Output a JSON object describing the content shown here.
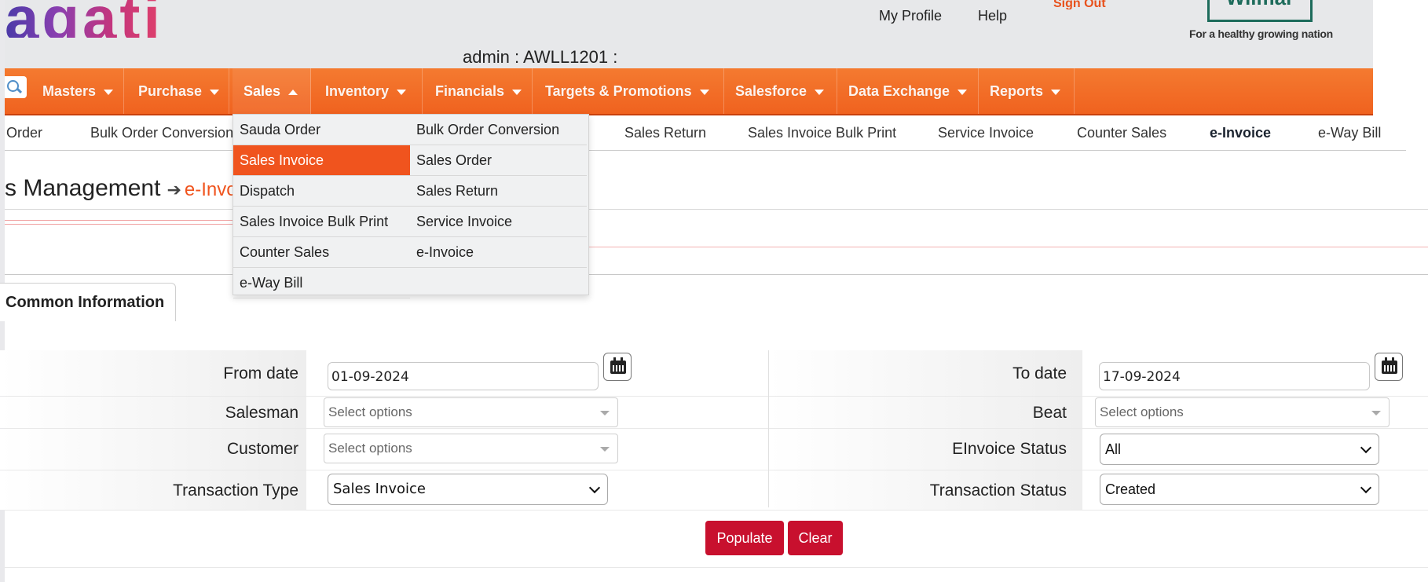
{
  "header": {
    "logo_text": "agati",
    "links": [
      "My Profile",
      "Help"
    ],
    "signout": "Sign Out",
    "brand_name": "Wilmar",
    "brand_tagline": "For a healthy growing nation",
    "user_line": "admin : AWLL1201 :"
  },
  "nav": {
    "items": [
      {
        "label": "Masters"
      },
      {
        "label": "Purchase"
      },
      {
        "label": "Sales"
      },
      {
        "label": "Inventory"
      },
      {
        "label": "Financials"
      },
      {
        "label": "Targets & Promotions"
      },
      {
        "label": "Salesforce"
      },
      {
        "label": "Data Exchange"
      },
      {
        "label": "Reports"
      }
    ],
    "active": "Sales"
  },
  "subnav": {
    "items": [
      "Order",
      "Bulk Order Conversion",
      "Sales Return",
      "Sales Invoice Bulk Print",
      "Service Invoice",
      "Counter Sales",
      "e-Invoice",
      "e-Way Bill"
    ],
    "active": "e-Invoice"
  },
  "page": {
    "title": "s Management",
    "breadcrumb": "e-Invc"
  },
  "dropdown": {
    "left": [
      "Sauda Order",
      "Sales Invoice",
      "Dispatch",
      "Sales Invoice Bulk Print",
      "Counter Sales",
      "e-Way Bill"
    ],
    "right": [
      "Bulk Order Conversion",
      "Sales Order",
      "Sales Return",
      "Service Invoice",
      "e-Invoice"
    ],
    "highlighted": "Sales Invoice",
    "highlight_color": "#f0541e"
  },
  "tab": {
    "label": "Common Information"
  },
  "form": {
    "from_date_label": "From date",
    "from_date_value": "01-09-2024",
    "to_date_label": "To date",
    "to_date_value": "17-09-2024",
    "salesman_label": "Salesman",
    "salesman_placeholder": "Select options",
    "beat_label": "Beat",
    "beat_placeholder": "Select options",
    "customer_label": "Customer",
    "customer_placeholder": "Select options",
    "einvoice_status_label": "EInvoice Status",
    "einvoice_status_value": "All",
    "transaction_type_label": "Transaction Type",
    "transaction_type_value": "Sales Invoice",
    "transaction_status_label": "Transaction Status",
    "transaction_status_value": "Created"
  },
  "buttons": {
    "populate": "Populate",
    "clear": "Clear",
    "color": "#c8102e"
  },
  "colors": {
    "nav_orange": "#f0621f",
    "accent_orange": "#f0541e"
  }
}
